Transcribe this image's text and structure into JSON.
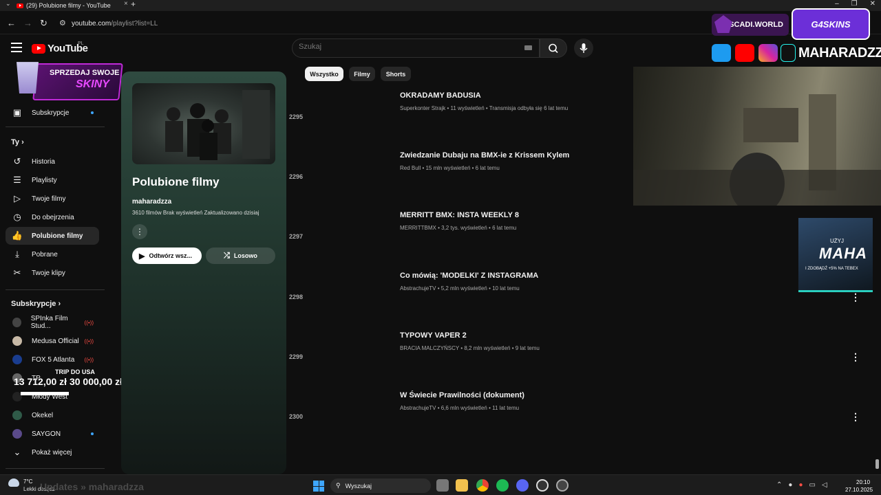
{
  "browser": {
    "tab_title": "(29) Polubione filmy - YouTube",
    "tab_close": "×",
    "new_tab": "+",
    "url_host": "youtube.com",
    "url_path": "/playlist?list=LL"
  },
  "youtube": {
    "logo_text": "YouTube",
    "country": "PL",
    "search_placeholder": "Szukaj"
  },
  "promo_overlay": {
    "line1": "SPRZEDAJ SWOJE",
    "line2": "SKINY"
  },
  "sidebar": {
    "subscriptions_item": "Subskrypcje",
    "you_header": "Ty",
    "you_items": [
      {
        "label": "Historia",
        "icon": "history-icon"
      },
      {
        "label": "Playlisty",
        "icon": "playlist-icon"
      },
      {
        "label": "Twoje filmy",
        "icon": "your-videos-icon"
      },
      {
        "label": "Do obejrzenia",
        "icon": "watch-later-icon"
      },
      {
        "label": "Polubione filmy",
        "icon": "like-icon"
      },
      {
        "label": "Pobrane",
        "icon": "download-icon"
      },
      {
        "label": "Twoje klipy",
        "icon": "clips-icon"
      }
    ],
    "subs_header": "Subskrypcje",
    "channels": [
      {
        "name": "SPInka Film Stud...",
        "status": "live"
      },
      {
        "name": "Medusa Official",
        "status": "live"
      },
      {
        "name": "FOX 5 Atlanta",
        "status": "live"
      },
      {
        "name": "TP",
        "status": ""
      },
      {
        "name": "Młody West",
        "status": ""
      },
      {
        "name": "Okekel",
        "status": ""
      },
      {
        "name": "SAYGON",
        "status": "new"
      }
    ],
    "show_more": "Pokaż więcej"
  },
  "donation": {
    "title": "TRIP DO USA",
    "amount": "13 712,00 zł   30 000,00 zł"
  },
  "playlist": {
    "title": "Polubione filmy",
    "owner": "maharadzza",
    "meta": "3610 filmów   Brak wyświetleń   Zaktualizowano dzisiaj",
    "play_all": "Odtwórz wsz...",
    "shuffle": "Losowo"
  },
  "chips": [
    "Wszystko",
    "Filmy",
    "Shorts"
  ],
  "videos": [
    {
      "num": "2295",
      "title": "OKRADAMY BADUSIA",
      "meta": "Superkonter Strajk • 11 wyświetleń • Transmisja odbyła się 6 lat temu"
    },
    {
      "num": "2296",
      "title": "Zwiedzanie Dubaju na BMX-ie z Krissem Kylem",
      "meta": "Red Bull • 15 mln wyświetleń • 6 lat temu"
    },
    {
      "num": "2297",
      "title": "MERRITT BMX: INSTA WEEKLY 8",
      "meta": "MERRITTBMX • 3,2 tys. wyświetleń • 6 lat temu"
    },
    {
      "num": "2298",
      "title": "Co mówią: 'MODELKI' Z INSTAGRAMA",
      "meta": "AbstrachujeTV • 5,2 mln wyświetleń • 10 lat temu"
    },
    {
      "num": "2299",
      "title": "TYPOWY VAPER 2",
      "meta": "BRACIA MALCZYŃSCY • 8,2 mln wyświetleń • 9 lat temu"
    },
    {
      "num": "2300",
      "title": "W Świecie Prawilności (dokument)",
      "meta": "AbstrachujeTV • 6,6 mln wyświetleń • 11 lat temu"
    }
  ],
  "stream_overlay": {
    "scadi": "SCADI.WORLD",
    "g4skins": "G4SKINS",
    "handle": "MAHARADZZA",
    "ad_line1": "UŻYJ",
    "ad_code": "MAHA",
    "ad_line3": "I ZDOBĄDŹ +5% NA TEBEX"
  },
  "taskbar": {
    "temp": "7°C",
    "weather": "Lekki deszcz",
    "marquee": "Updates » maharadzza",
    "search": "Wyszukaj",
    "time": "20:10",
    "date": "27.10.2025"
  },
  "colors": {
    "accent_red": "#ff0000",
    "panel_green": "#2f4a40",
    "live_red": "#ff4e45",
    "new_dot": "#3ea6ff"
  }
}
